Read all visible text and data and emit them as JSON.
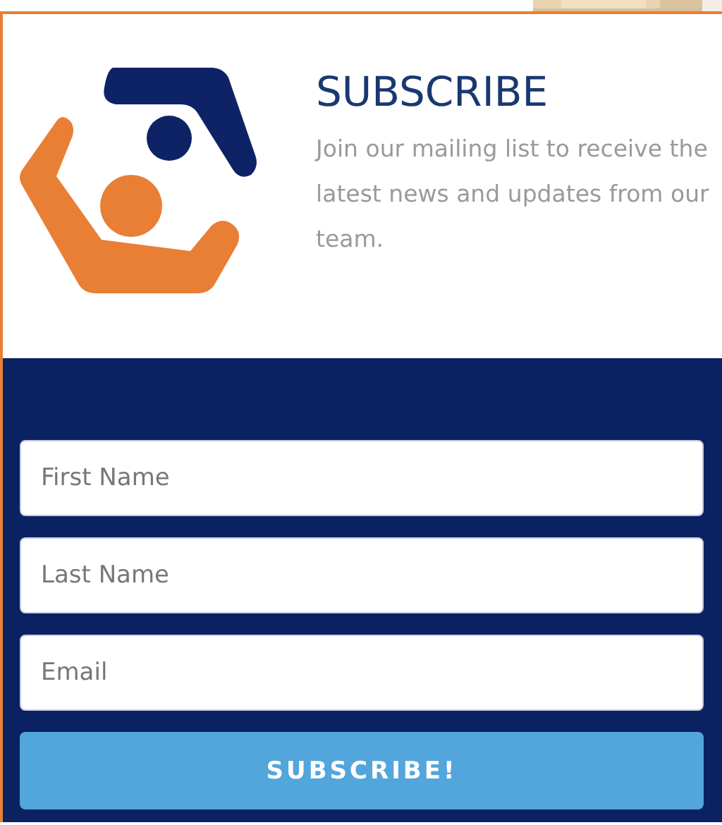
{
  "heading": "SUBSCRIBE",
  "description": "Join our mailing list to receive the latest news and updates from our team.",
  "fields": [
    {
      "placeholder": "First Name"
    },
    {
      "placeholder": "Last Name"
    },
    {
      "placeholder": "Email"
    }
  ],
  "button": "SUBSCRIBE!"
}
